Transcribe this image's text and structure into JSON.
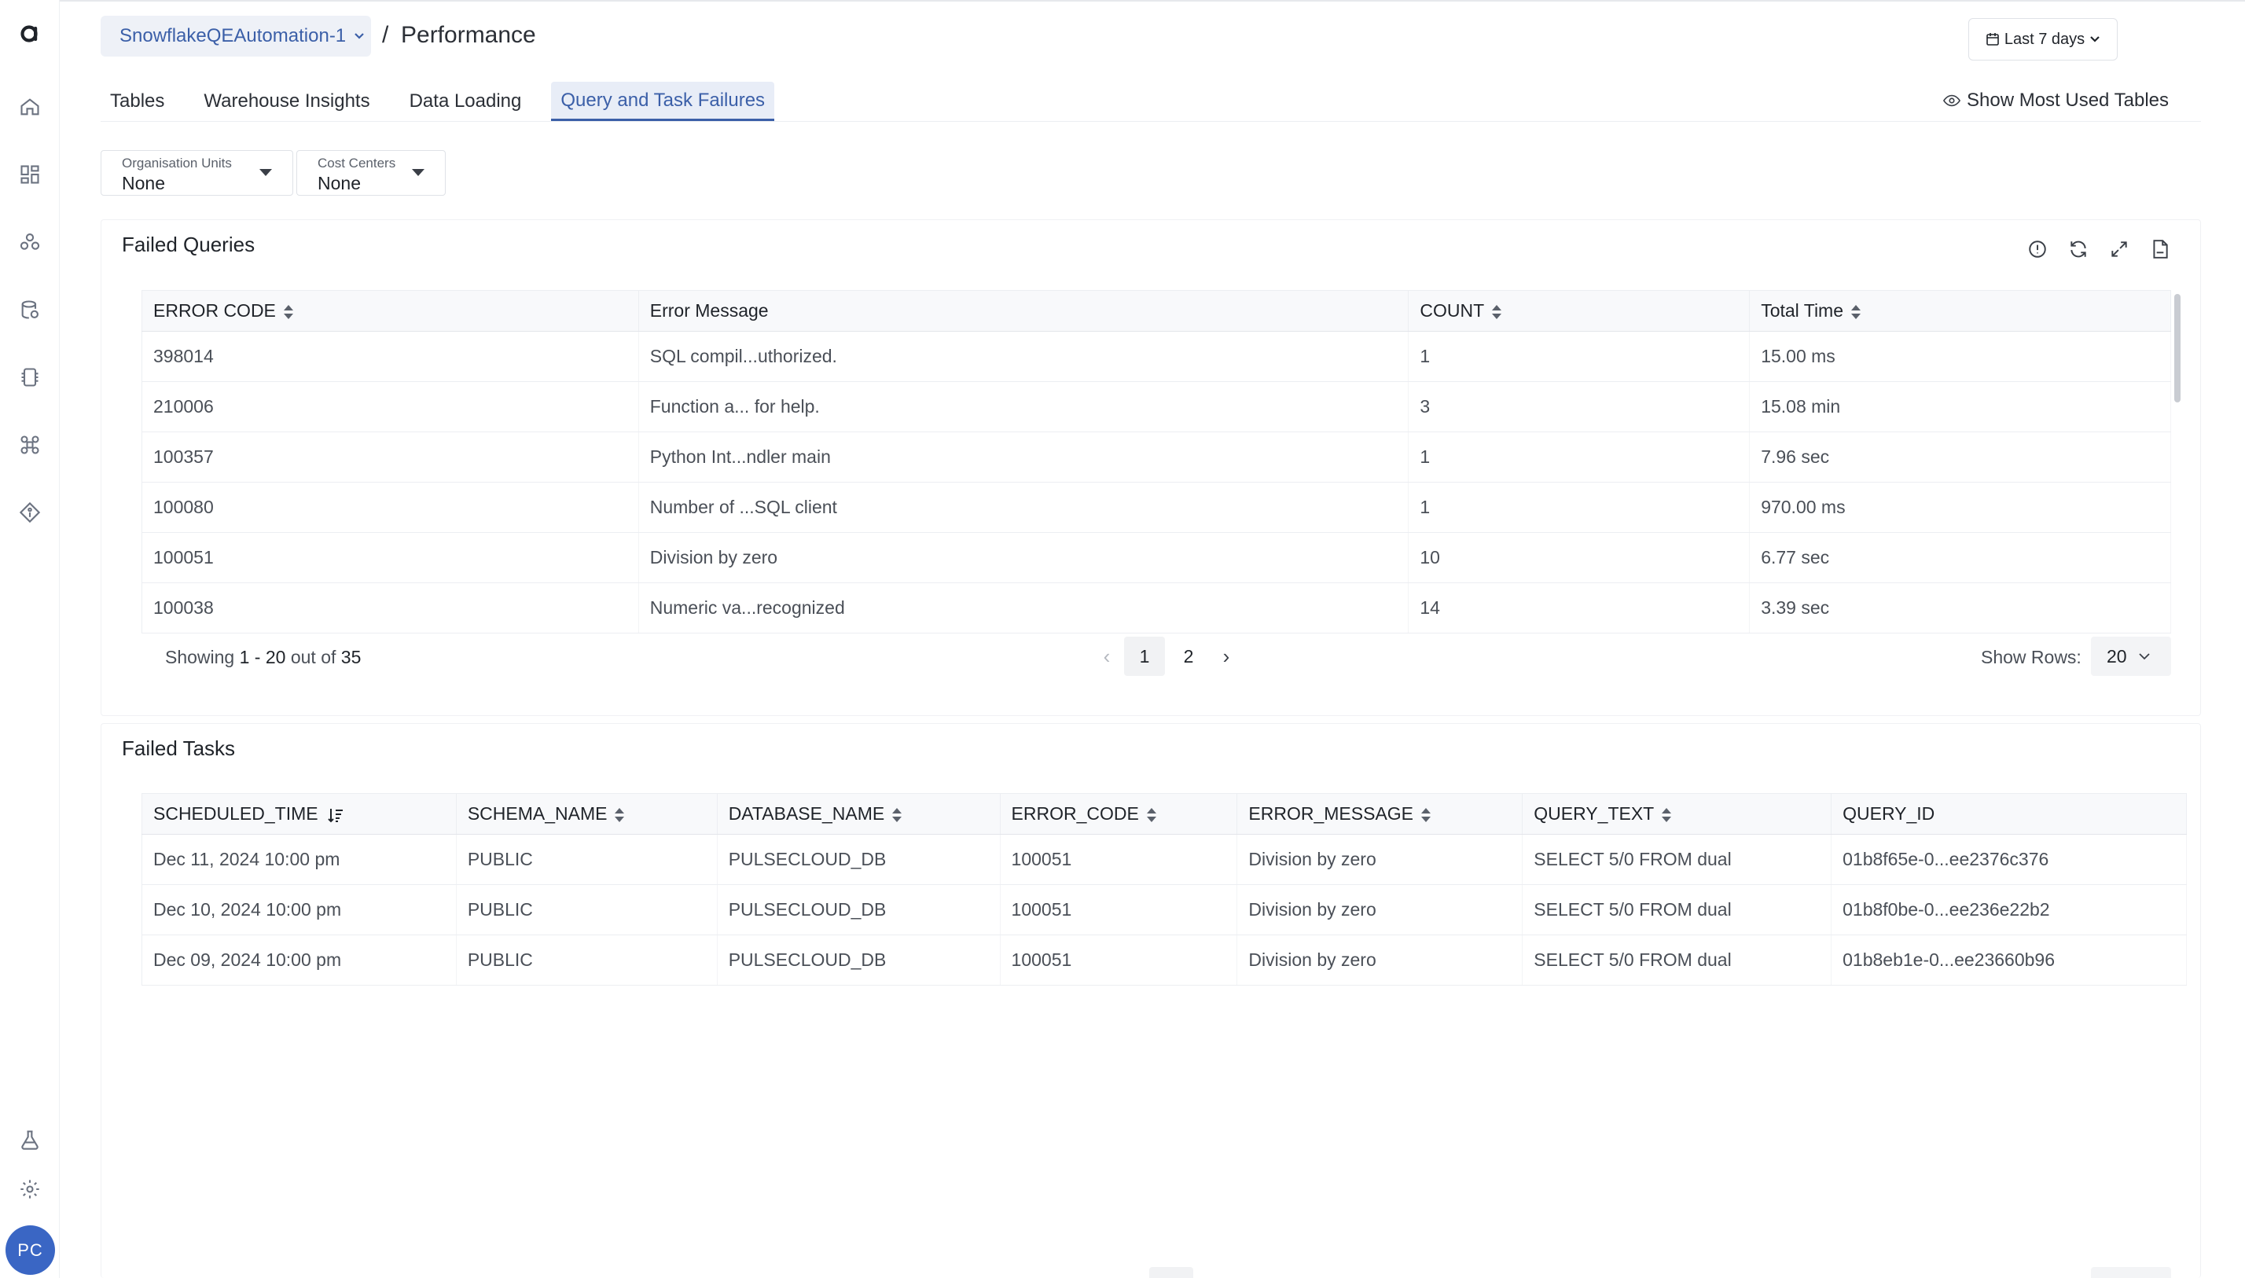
{
  "sidebar": {
    "logo": "a",
    "icons": [
      "home-icon",
      "dashboard-icon",
      "users-icon",
      "database-icon",
      "chip-icon",
      "command-icon",
      "tag-icon",
      "flask-icon",
      "gear-icon"
    ],
    "avatar_initials": "PC"
  },
  "header": {
    "account": "SnowflakeQEAutomation-1",
    "separator": "/",
    "page_title": "Performance",
    "date_range": "Last 7 days"
  },
  "tabs": [
    {
      "label": "Tables",
      "active": false
    },
    {
      "label": "Warehouse Insights",
      "active": false
    },
    {
      "label": "Data Loading",
      "active": false
    },
    {
      "label": "Query and Task Failures",
      "active": true
    }
  ],
  "show_most_used": "Show Most Used Tables",
  "filters": {
    "org_units": {
      "label": "Organisation Units",
      "value": "None"
    },
    "cost_centers": {
      "label": "Cost Centers",
      "value": "None"
    }
  },
  "failed_queries": {
    "title": "Failed Queries",
    "columns": [
      "ERROR CODE",
      "Error Message",
      "COUNT",
      "Total Time"
    ],
    "rows": [
      [
        "398014",
        "SQL compil...uthorized.",
        "1",
        "15.00 ms"
      ],
      [
        "210006",
        "Function a... for help.",
        "3",
        "15.08 min"
      ],
      [
        "100357",
        "Python Int...ndler main",
        "1",
        "7.96 sec"
      ],
      [
        "100080",
        "Number of ...SQL client",
        "1",
        "970.00 ms"
      ],
      [
        "100051",
        "Division by zero",
        "10",
        "6.77 sec"
      ],
      [
        "100038",
        "Numeric va...recognized",
        "14",
        "3.39 sec"
      ]
    ],
    "pagination": {
      "showing_prefix": "Showing",
      "range": "1 - 20",
      "out_of": "out of",
      "total": "35",
      "pages": [
        "1",
        "2"
      ],
      "current": "1",
      "rows_label": "Show Rows:",
      "rows_value": "20"
    }
  },
  "failed_tasks": {
    "title": "Failed Tasks",
    "columns": [
      "SCHEDULED_TIME",
      "SCHEMA_NAME",
      "DATABASE_NAME",
      "ERROR_CODE",
      "ERROR_MESSAGE",
      "QUERY_TEXT",
      "QUERY_ID"
    ],
    "rows": [
      [
        "Dec 11, 2024 10:00 pm",
        "PUBLIC",
        "PULSECLOUD_DB",
        "100051",
        "Division by zero",
        "SELECT 5/0 FROM dual",
        "01b8f65e-0...ee2376c376"
      ],
      [
        "Dec 10, 2024 10:00 pm",
        "PUBLIC",
        "PULSECLOUD_DB",
        "100051",
        "Division by zero",
        "SELECT 5/0 FROM dual",
        "01b8f0be-0...ee236e22b2"
      ],
      [
        "Dec 09, 2024 10:00 pm",
        "PUBLIC",
        "PULSECLOUD_DB",
        "100051",
        "Division by zero",
        "SELECT 5/0 FROM dual",
        "01b8eb1e-0...ee23660b96"
      ]
    ]
  },
  "colors": {
    "accent": "#3b5fa8",
    "avatar": "#3a66c4"
  }
}
